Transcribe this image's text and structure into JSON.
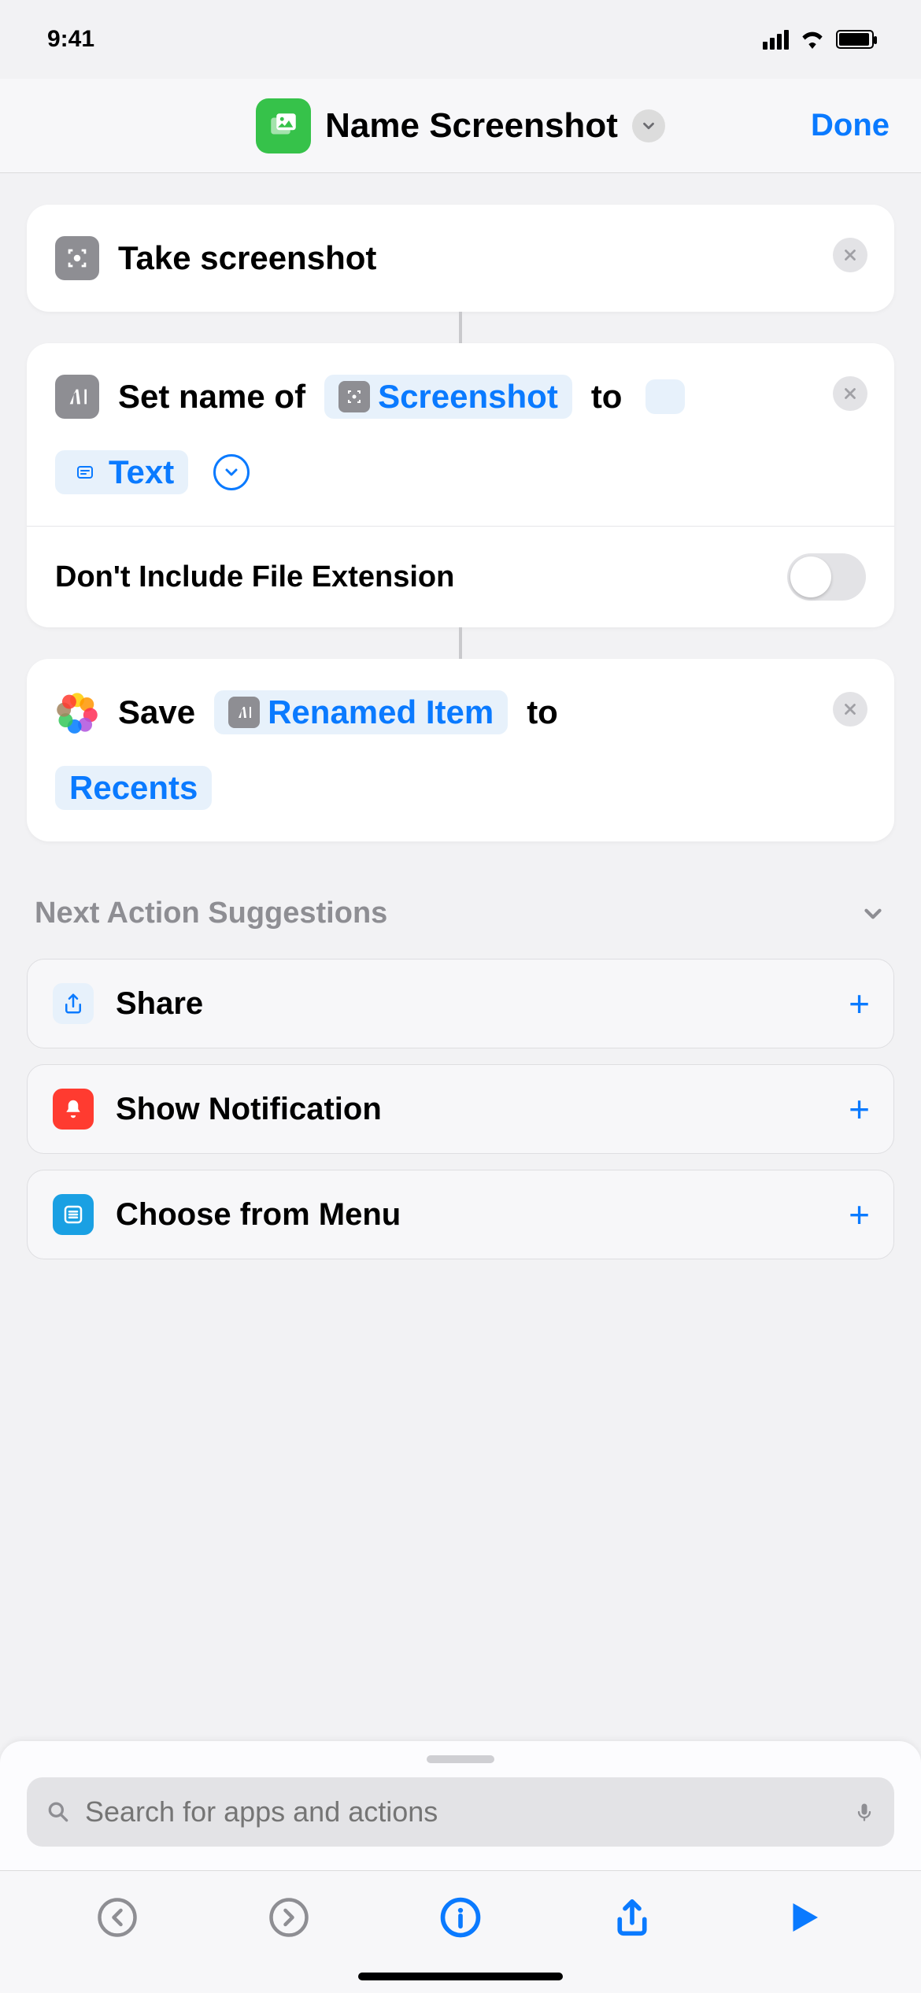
{
  "status": {
    "time": "9:41"
  },
  "header": {
    "title": "Name Screenshot",
    "done": "Done"
  },
  "actions": {
    "a1": {
      "title": "Take screenshot"
    },
    "a2": {
      "prefix": "Set name of",
      "var_label": "Screenshot",
      "mid": "to",
      "text_token": "Text",
      "opt_label": "Don't Include File Extension"
    },
    "a3": {
      "prefix": "Save",
      "var_label": "Renamed Item",
      "mid": "to",
      "dest": "Recents"
    }
  },
  "suggestions": {
    "header": "Next Action Suggestions",
    "items": {
      "s1": "Share",
      "s2": "Show Notification",
      "s3": "Choose from Menu"
    }
  },
  "search": {
    "placeholder": "Search for apps and actions"
  }
}
